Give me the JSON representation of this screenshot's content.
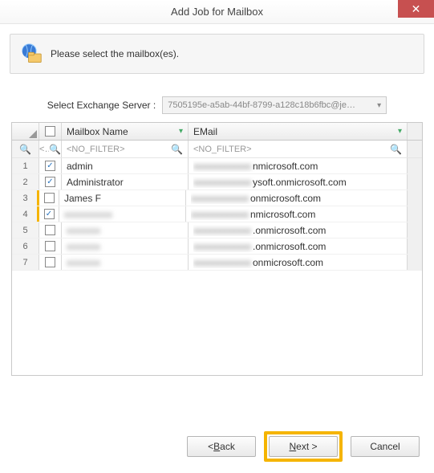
{
  "window": {
    "title": "Add Job for Mailbox",
    "close_glyph": "✕"
  },
  "info": {
    "text": "Please select the mailbox(es)."
  },
  "server": {
    "label": "Select Exchange Server :",
    "value": "7505195e-a5ab-44bf-8799-a128c18b6fbc@je…"
  },
  "grid": {
    "headers": {
      "name": "Mailbox Name",
      "email": "EMail"
    },
    "filter": {
      "placeholder": "<NO_FILTER>",
      "short": "<.."
    },
    "rows": [
      {
        "n": "1",
        "checked": true,
        "name": "admin",
        "name_blur": false,
        "email_blur": "xxxxxxxxxxxx",
        "email_suffix": "nmicrosoft.com",
        "hl": false
      },
      {
        "n": "2",
        "checked": true,
        "name": "Administrator",
        "name_blur": false,
        "email_blur": "xxxxxxxxxxxx",
        "email_suffix": "ysoft.onmicrosoft.com",
        "hl": false
      },
      {
        "n": "3",
        "checked": false,
        "name": "James F",
        "name_blur": false,
        "email_blur": "xxxxxxxxxxxx",
        "email_suffix": "onmicrosoft.com",
        "hl": true
      },
      {
        "n": "4",
        "checked": true,
        "name": "xxxxxxxxxx",
        "name_blur": true,
        "email_blur": "xxxxxxxxxxxx",
        "email_suffix": "nmicrosoft.com",
        "hl": true
      },
      {
        "n": "5",
        "checked": false,
        "name": "xxxxxxx",
        "name_blur": true,
        "email_blur": "xxxxxxxxxxxx",
        "email_suffix": ".onmicrosoft.com",
        "hl": false
      },
      {
        "n": "6",
        "checked": false,
        "name": "xxxxxxx",
        "name_blur": true,
        "email_blur": "xxxxxxxxxxxx",
        "email_suffix": ".onmicrosoft.com",
        "hl": false
      },
      {
        "n": "7",
        "checked": false,
        "name": "xxxxxxx",
        "name_blur": true,
        "email_blur": "xxxxxxxxxxxx",
        "email_suffix": "onmicrosoft.com",
        "hl": false
      }
    ]
  },
  "buttons": {
    "back_prefix": "< ",
    "back_ul": "B",
    "back_suffix": "ack",
    "next_ul": "N",
    "next_suffix": "ext >",
    "cancel": "Cancel"
  }
}
